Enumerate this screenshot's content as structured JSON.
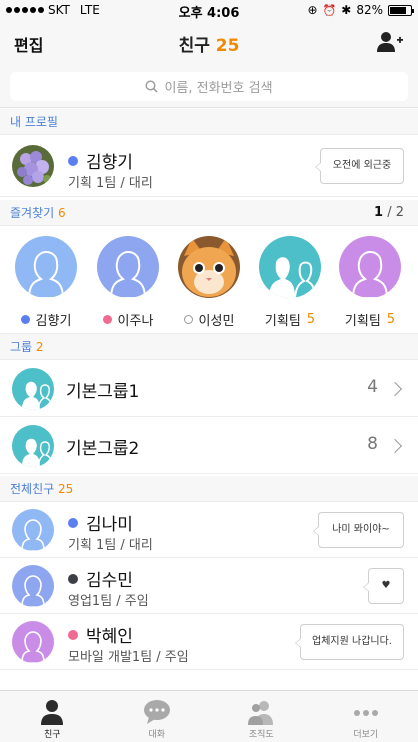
{
  "status_bar": {
    "carrier": "SKT",
    "network": "LTE",
    "time": "오후 4:06",
    "battery_text": "82%",
    "battery_level": 0.82
  },
  "nav": {
    "edit_label": "편집",
    "title": "친구",
    "count": "25"
  },
  "search": {
    "placeholder": "이름, 전화번호 검색"
  },
  "my_profile": {
    "section_label": "내 프로필",
    "name": "김향기",
    "subtitle": "기획 1팀 / 대리",
    "status_message": "오전에 외근중",
    "status_color": "#5b7ff0"
  },
  "favorites": {
    "section_label": "즐겨찾기",
    "count": "6",
    "page_current": "1",
    "page_separator": " / ",
    "page_total": "2",
    "items": [
      {
        "label": "김향기",
        "count": "",
        "status": "#5b7ff0",
        "avatar_color": "#8fb8f5",
        "kind": "person"
      },
      {
        "label": "이주나",
        "count": "",
        "status": "#f06a92",
        "avatar_color": "#8ea6f0",
        "kind": "person"
      },
      {
        "label": "이성민",
        "count": "",
        "status": "hollow",
        "avatar_color": "#e8943a",
        "kind": "cat"
      },
      {
        "label": "기획팀",
        "count": "5",
        "status": "",
        "avatar_color": "#4cbfc8",
        "kind": "group"
      },
      {
        "label": "기획팀",
        "count": "5",
        "status": "",
        "avatar_color": "#c98de8",
        "kind": "person"
      }
    ]
  },
  "groups": {
    "section_label": "그룹",
    "count": "2",
    "items": [
      {
        "name": "기본그룹1",
        "count": "4"
      },
      {
        "name": "기본그룹2",
        "count": "8"
      }
    ]
  },
  "all_friends": {
    "section_label": "전체친구",
    "count": "25",
    "items": [
      {
        "name": "김나미",
        "subtitle": "기획 1팀 / 대리",
        "status_message": "나미 뫄이야~",
        "dot": "#5b7ff0",
        "avatar_color": "#8fb8f5"
      },
      {
        "name": "김수민",
        "subtitle": "영업1팀 / 주임",
        "status_message": "♥",
        "dot": "#3c4046",
        "avatar_color": "#8ea6f0"
      },
      {
        "name": "박혜인",
        "subtitle": "모바일 개발1팀 / 주임",
        "status_message": "업체지원 나갑니다.",
        "dot": "#f06a92",
        "avatar_color": "#c98de8"
      }
    ]
  },
  "tab_bar": {
    "tabs": [
      {
        "label": "친구",
        "icon": "person-icon",
        "active": true
      },
      {
        "label": "대화",
        "icon": "chat-bubble-icon",
        "active": false
      },
      {
        "label": "조직도",
        "icon": "org-chart-icon",
        "active": false
      },
      {
        "label": "더보기",
        "icon": "more-dots-icon",
        "active": false
      }
    ]
  }
}
